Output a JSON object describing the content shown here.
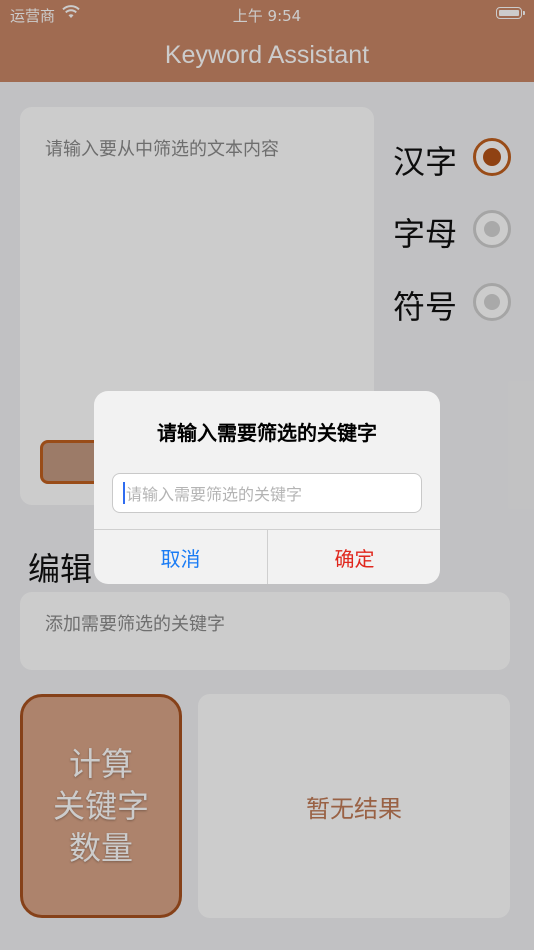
{
  "status_bar": {
    "carrier": "运营商",
    "time": "上午 9:54"
  },
  "nav": {
    "title": "Keyword Assistant"
  },
  "text_input": {
    "placeholder": "请输入要从中筛选的文本内容"
  },
  "filters": [
    {
      "label": "汉字",
      "selected": true
    },
    {
      "label": "字母",
      "selected": false
    },
    {
      "label": "符号",
      "selected": false
    }
  ],
  "edit_section": {
    "title_visible": "编辑"
  },
  "keyword_input": {
    "placeholder": "添加需要筛选的关键字"
  },
  "calc_button": {
    "label": "计算\n关键字\n数量"
  },
  "result": {
    "text": "暂无结果"
  },
  "dialog": {
    "title": "请输入需要筛选的关键字",
    "input_placeholder": "请输入需要筛选的关键字",
    "cancel_label": "取消",
    "ok_label": "确定"
  },
  "colors": {
    "brand": "#c88666",
    "accent": "#b35318",
    "cancel": "#1a7cf5",
    "confirm": "#e0281e"
  }
}
